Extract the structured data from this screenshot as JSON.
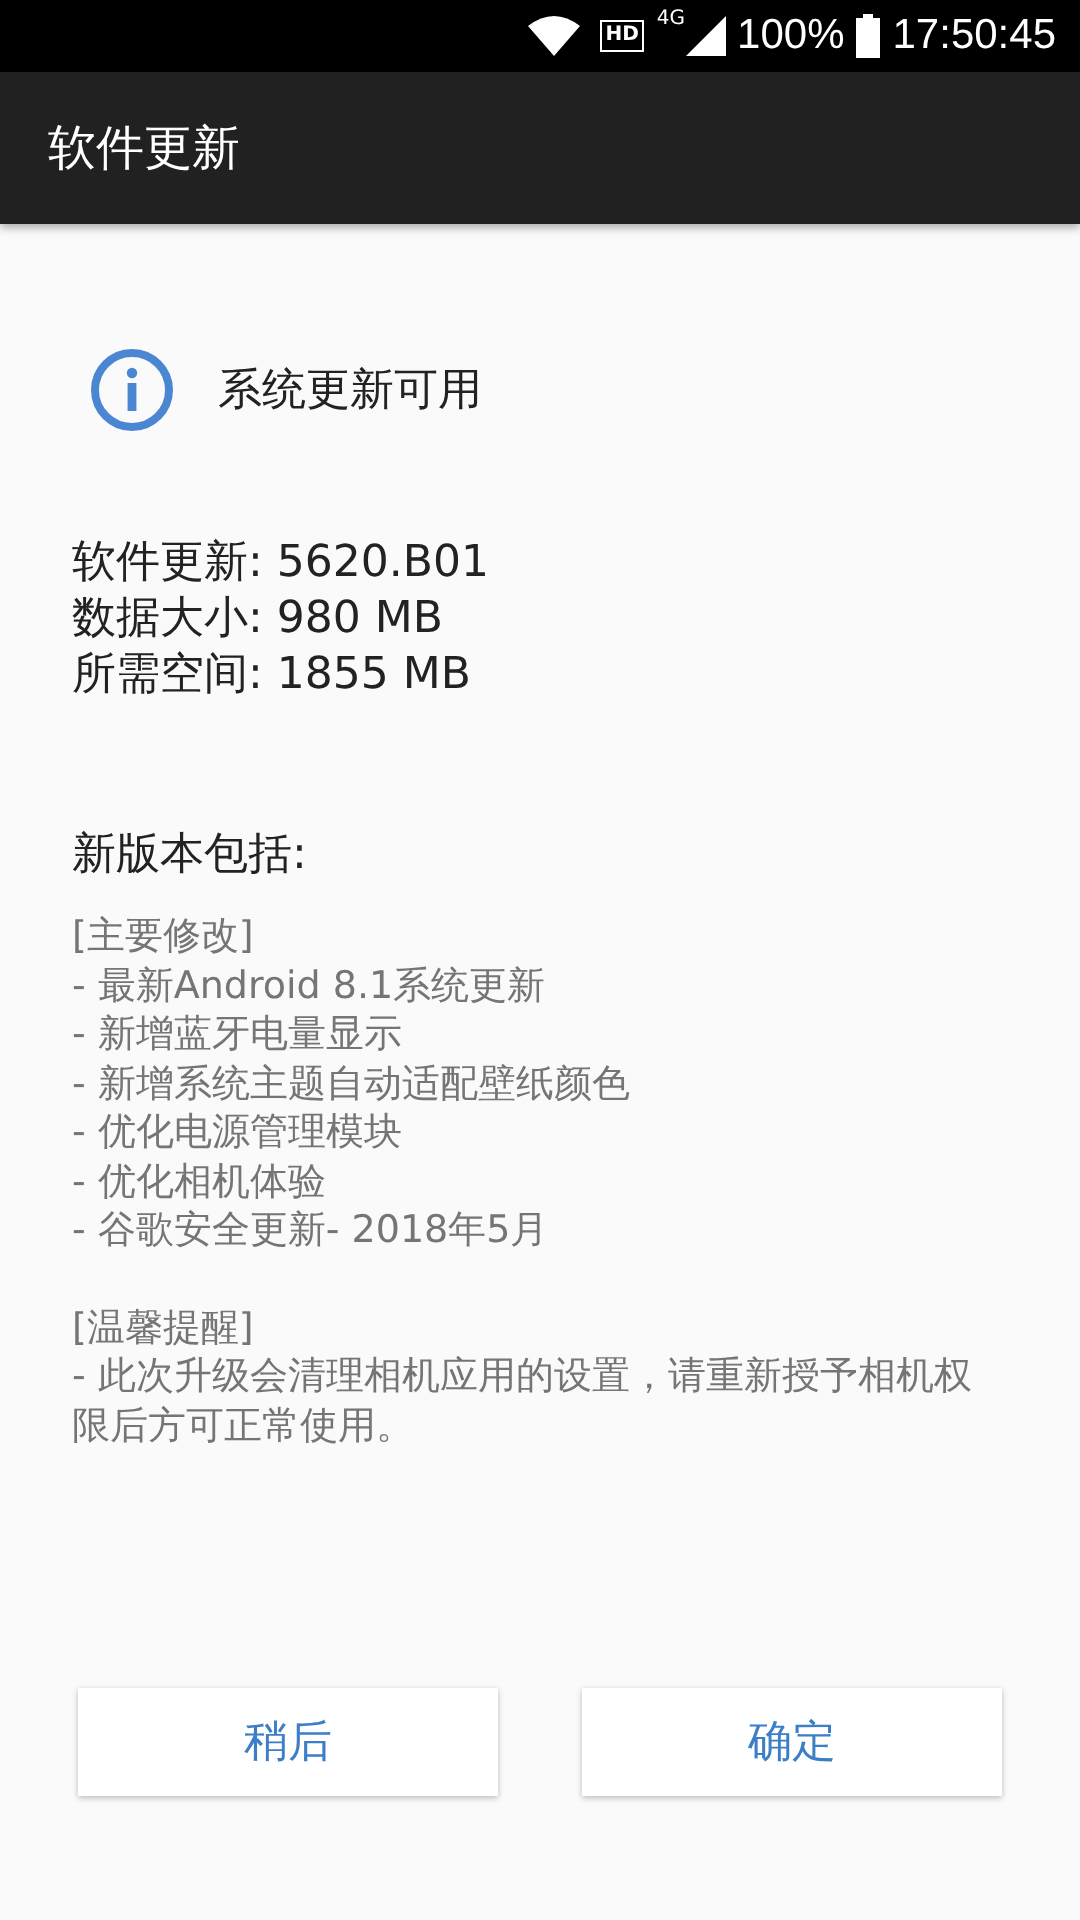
{
  "status_bar": {
    "hd": "HD",
    "network": "4G",
    "battery": "100%",
    "time": "17:50:45"
  },
  "toolbar": {
    "title": "软件更新"
  },
  "notice": {
    "title": "系统更新可用"
  },
  "details": [
    "软件更新: 5620.B01",
    "数据大小: 980 MB",
    "所需空间: 1855 MB"
  ],
  "changelog": {
    "heading": "新版本包括:",
    "sections": [
      {
        "title": "[主要修改]",
        "lines": [
          "- 最新Android 8.1系统更新",
          "- 新增蓝牙电量显示",
          "- 新增系统主题自动适配壁纸颜色",
          "- 优化电源管理模块",
          "- 优化相机体验",
          "- 谷歌安全更新- 2018年5月"
        ]
      },
      {
        "title": "[温馨提醒]",
        "lines": [
          "- 此次升级会清理相机应用的设置，请重新授予相机权限后方可正常使用。"
        ]
      }
    ]
  },
  "buttons": [
    "稍后",
    "确定"
  ]
}
